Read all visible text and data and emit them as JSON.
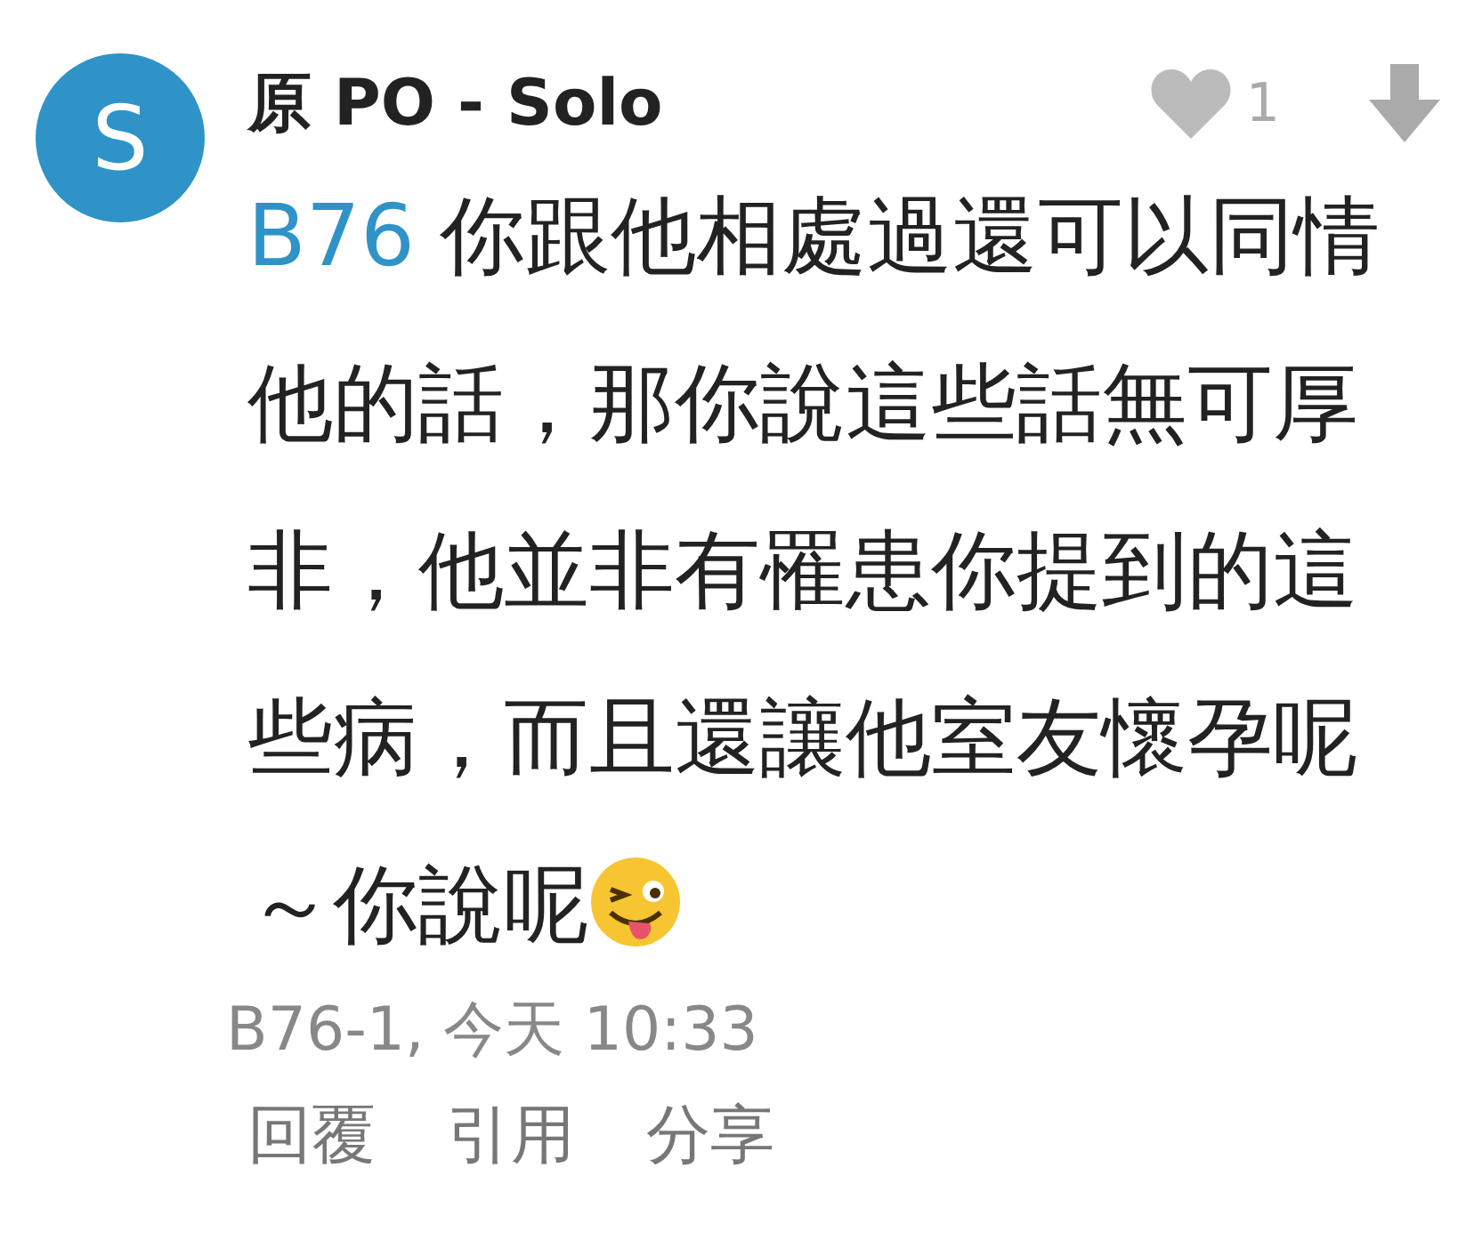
{
  "avatar": {
    "letter": "S",
    "color": "#2f93c8"
  },
  "author": "原 PO - Solo",
  "likes": {
    "count": "1"
  },
  "body": {
    "reply_ref": "B76",
    "text": "你跟他相處過還可以同情他的話，那你說這些話無可厚非，他並非有罹患你提到的這些病，而且還讓他室友懷孕呢～你說呢"
  },
  "meta": "B76-1, 今天 10:33",
  "actions": [
    "回覆",
    "引用",
    "分享"
  ]
}
